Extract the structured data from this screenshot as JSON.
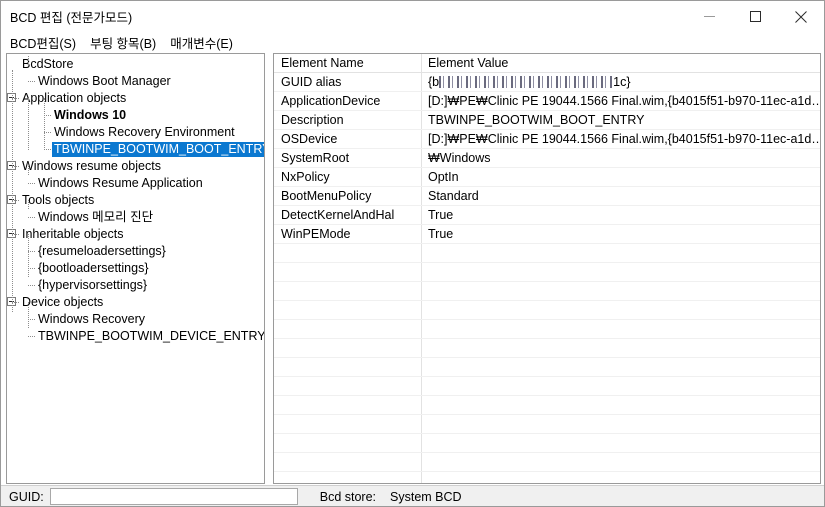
{
  "window": {
    "title": "BCD 편집 (전문가모드)",
    "controls": {
      "minimize": "minimize-icon",
      "maximize": "maximize-icon",
      "close": "close-icon"
    }
  },
  "menubar": {
    "items": [
      {
        "label": "BCD편집(S)"
      },
      {
        "label": "부팅 항목(B)"
      },
      {
        "label": "매개변수(E)"
      }
    ]
  },
  "tree": {
    "nodes": [
      {
        "label": "BcdStore",
        "depth": 0,
        "expander": false,
        "bold": false,
        "selected": false
      },
      {
        "label": "Windows Boot Manager",
        "depth": 1,
        "expander": false,
        "bold": false,
        "selected": false
      },
      {
        "label": "Application objects",
        "depth": 0,
        "expander": true,
        "bold": false,
        "selected": false
      },
      {
        "label": "Windows 10",
        "depth": 2,
        "expander": false,
        "bold": true,
        "selected": false
      },
      {
        "label": "Windows Recovery Environment",
        "depth": 2,
        "expander": false,
        "bold": false,
        "selected": false
      },
      {
        "label": "TBWINPE_BOOTWIM_BOOT_ENTRY",
        "depth": 2,
        "expander": false,
        "bold": false,
        "selected": true
      },
      {
        "label": "Windows resume objects",
        "depth": 0,
        "expander": true,
        "bold": false,
        "selected": false
      },
      {
        "label": "Windows Resume Application",
        "depth": 1,
        "expander": false,
        "bold": false,
        "selected": false
      },
      {
        "label": "Tools objects",
        "depth": 0,
        "expander": true,
        "bold": false,
        "selected": false
      },
      {
        "label": "Windows 메모리 진단",
        "depth": 1,
        "expander": false,
        "bold": false,
        "selected": false
      },
      {
        "label": "Inheritable objects",
        "depth": 0,
        "expander": true,
        "bold": false,
        "selected": false
      },
      {
        "label": "{resumeloadersettings}",
        "depth": 1,
        "expander": false,
        "bold": false,
        "selected": false
      },
      {
        "label": "{bootloadersettings}",
        "depth": 1,
        "expander": false,
        "bold": false,
        "selected": false
      },
      {
        "label": "{hypervisorsettings}",
        "depth": 1,
        "expander": false,
        "bold": false,
        "selected": false
      },
      {
        "label": "Device objects",
        "depth": 0,
        "expander": true,
        "bold": false,
        "selected": false
      },
      {
        "label": "Windows Recovery",
        "depth": 1,
        "expander": false,
        "bold": false,
        "selected": false
      },
      {
        "label": "TBWINPE_BOOTWIM_DEVICE_ENTRY",
        "depth": 1,
        "expander": false,
        "bold": false,
        "selected": false
      }
    ]
  },
  "list": {
    "columns": [
      "Element Name",
      "Element Value"
    ],
    "rows": [
      {
        "name": "GUID alias",
        "value": "{b",
        "value_suffix": "1c}",
        "redacted": true
      },
      {
        "name": "ApplicationDevice",
        "value": "[D:]₩PE₩Clinic PE 19044.1566 Final.wim,{b4015f51-b970-11ec-a1d…",
        "redacted": false
      },
      {
        "name": "Description",
        "value": "TBWINPE_BOOTWIM_BOOT_ENTRY",
        "redacted": false
      },
      {
        "name": "OSDevice",
        "value": "[D:]₩PE₩Clinic PE 19044.1566 Final.wim,{b4015f51-b970-11ec-a1d…",
        "redacted": false
      },
      {
        "name": "SystemRoot",
        "value": "₩Windows",
        "redacted": false
      },
      {
        "name": "NxPolicy",
        "value": "OptIn",
        "redacted": false
      },
      {
        "name": "BootMenuPolicy",
        "value": "Standard",
        "redacted": false
      },
      {
        "name": "DetectKernelAndHal",
        "value": "True",
        "redacted": false
      },
      {
        "name": "WinPEMode",
        "value": "True",
        "redacted": false
      }
    ],
    "empty_row_count": 12
  },
  "statusbar": {
    "guid_label": "GUID:",
    "guid_value": "",
    "store_label": "Bcd store:",
    "store_value": "System BCD"
  },
  "colors": {
    "selection": "#0b78d0",
    "panel_border": "#9a9a9a",
    "status_background": "#f0f0f0"
  }
}
